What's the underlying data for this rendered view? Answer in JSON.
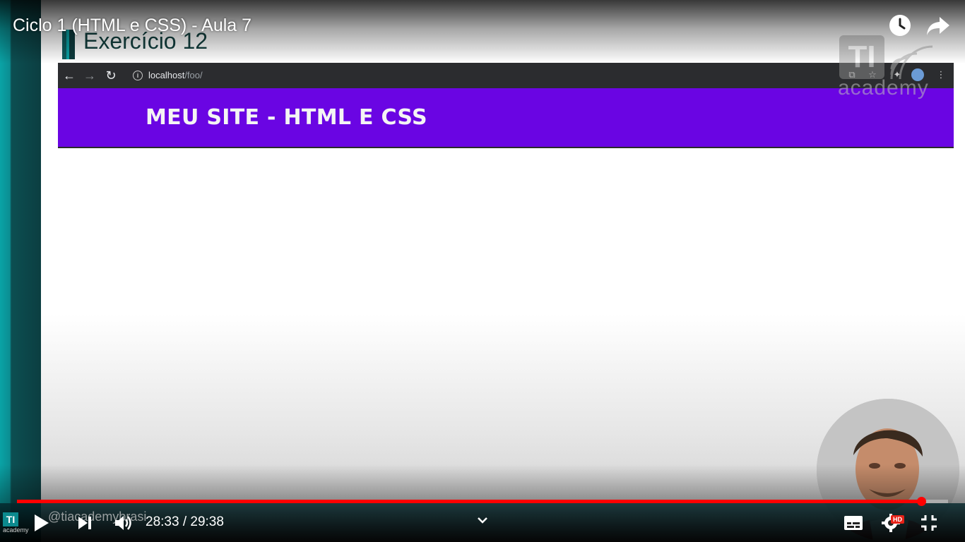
{
  "player": {
    "video_title": "Ciclo 1 (HTML e CSS) - Aula 7",
    "current_time": "28:33",
    "duration": "29:38",
    "time_display": "28:33 / 29:38",
    "progress_fraction": 0.971,
    "progress_color": "#ff0000",
    "hd_badge": "HD",
    "channel_handle": "@tiacademybrasi",
    "top_actions": [
      "watch-later-icon",
      "share-icon"
    ],
    "bottom_controls": [
      "play-icon",
      "next-icon",
      "volume-icon",
      "chevron-down-icon",
      "subtitles-icon",
      "settings-icon",
      "exit-fullscreen-icon"
    ]
  },
  "slide": {
    "title": "Exercício 12",
    "browser": {
      "url_host": "localhost",
      "url_path": "/foo/",
      "site_title": "MEU SITE - HTML E CSS",
      "header_color": "#6a05e3"
    }
  },
  "watermark": {
    "logo_letters": "TI",
    "logo_text": "academy"
  },
  "mini_logo": {
    "letters": "TI",
    "text": "academy"
  }
}
